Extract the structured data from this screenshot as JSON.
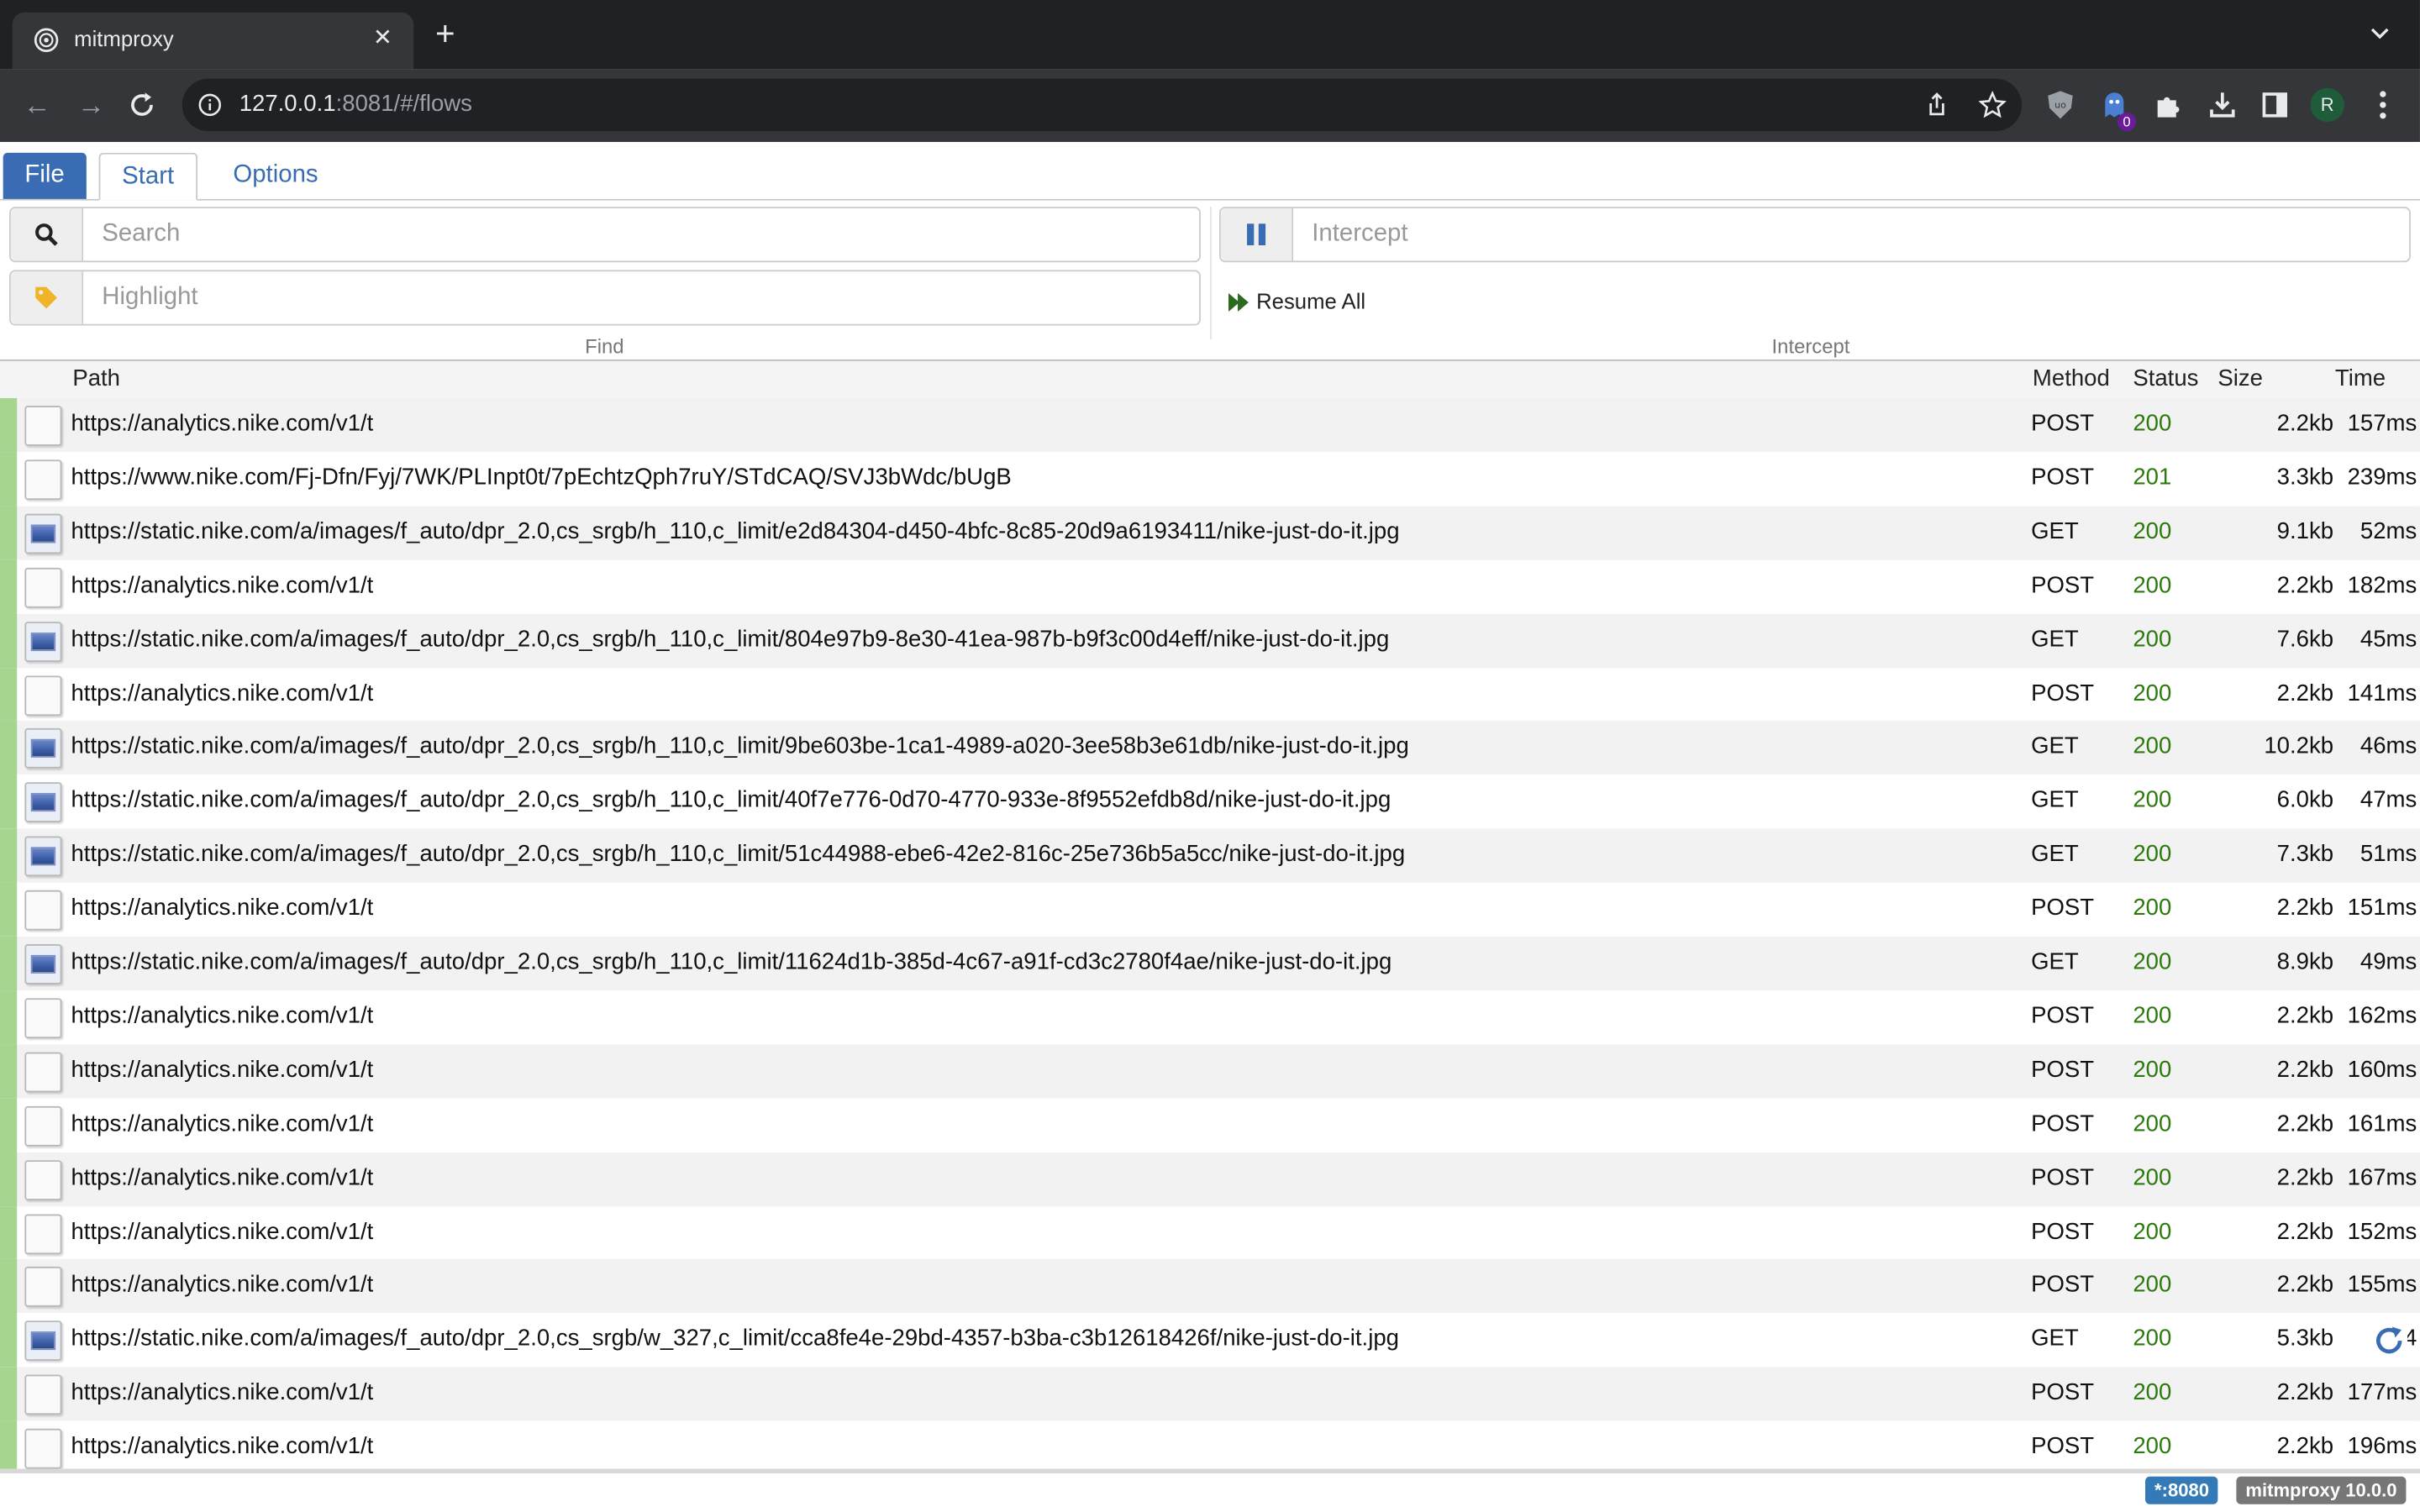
{
  "browser": {
    "tab_title": "mitmproxy",
    "url_host": "127.0.0.1",
    "url_rest": ":8081/#/flows",
    "avatar_letter": "R",
    "extension_badge": "0"
  },
  "menu": {
    "tabs": [
      "File",
      "Start",
      "Options"
    ],
    "search_placeholder": "Search",
    "highlight_placeholder": "Highlight",
    "intercept_placeholder": "Intercept",
    "resume_all": "Resume All",
    "find_label": "Find",
    "intercept_label": "Intercept"
  },
  "table": {
    "columns": [
      "Path",
      "Method",
      "Status",
      "Size",
      "Time"
    ],
    "rows": [
      {
        "icon": "plain",
        "path": "https://analytics.nike.com/v1/t",
        "method": "POST",
        "status": "200",
        "size": "2.2kb",
        "time": "157ms"
      },
      {
        "icon": "plain",
        "path": "https://www.nike.com/Fj-Dfn/Fyj/7WK/PLInpt0t/7pEchtzQph7ruY/STdCAQ/SVJ3bWdc/bUgB",
        "method": "POST",
        "status": "201",
        "size": "3.3kb",
        "time": "239ms"
      },
      {
        "icon": "image",
        "path": "https://static.nike.com/a/images/f_auto/dpr_2.0,cs_srgb/h_110,c_limit/e2d84304-d450-4bfc-8c85-20d9a6193411/nike-just-do-it.jpg",
        "method": "GET",
        "status": "200",
        "size": "9.1kb",
        "time": "52ms"
      },
      {
        "icon": "plain",
        "path": "https://analytics.nike.com/v1/t",
        "method": "POST",
        "status": "200",
        "size": "2.2kb",
        "time": "182ms"
      },
      {
        "icon": "image",
        "path": "https://static.nike.com/a/images/f_auto/dpr_2.0,cs_srgb/h_110,c_limit/804e97b9-8e30-41ea-987b-b9f3c00d4eff/nike-just-do-it.jpg",
        "method": "GET",
        "status": "200",
        "size": "7.6kb",
        "time": "45ms"
      },
      {
        "icon": "plain",
        "path": "https://analytics.nike.com/v1/t",
        "method": "POST",
        "status": "200",
        "size": "2.2kb",
        "time": "141ms"
      },
      {
        "icon": "image",
        "path": "https://static.nike.com/a/images/f_auto/dpr_2.0,cs_srgb/h_110,c_limit/9be603be-1ca1-4989-a020-3ee58b3e61db/nike-just-do-it.jpg",
        "method": "GET",
        "status": "200",
        "size": "10.2kb",
        "time": "46ms"
      },
      {
        "icon": "image",
        "path": "https://static.nike.com/a/images/f_auto/dpr_2.0,cs_srgb/h_110,c_limit/40f7e776-0d70-4770-933e-8f9552efdb8d/nike-just-do-it.jpg",
        "method": "GET",
        "status": "200",
        "size": "6.0kb",
        "time": "47ms"
      },
      {
        "icon": "image",
        "path": "https://static.nike.com/a/images/f_auto/dpr_2.0,cs_srgb/h_110,c_limit/51c44988-ebe6-42e2-816c-25e736b5a5cc/nike-just-do-it.jpg",
        "method": "GET",
        "status": "200",
        "size": "7.3kb",
        "time": "51ms"
      },
      {
        "icon": "plain",
        "path": "https://analytics.nike.com/v1/t",
        "method": "POST",
        "status": "200",
        "size": "2.2kb",
        "time": "151ms"
      },
      {
        "icon": "image",
        "path": "https://static.nike.com/a/images/f_auto/dpr_2.0,cs_srgb/h_110,c_limit/11624d1b-385d-4c67-a91f-cd3c2780f4ae/nike-just-do-it.jpg",
        "method": "GET",
        "status": "200",
        "size": "8.9kb",
        "time": "49ms"
      },
      {
        "icon": "plain",
        "path": "https://analytics.nike.com/v1/t",
        "method": "POST",
        "status": "200",
        "size": "2.2kb",
        "time": "162ms"
      },
      {
        "icon": "plain",
        "path": "https://analytics.nike.com/v1/t",
        "method": "POST",
        "status": "200",
        "size": "2.2kb",
        "time": "160ms"
      },
      {
        "icon": "plain",
        "path": "https://analytics.nike.com/v1/t",
        "method": "POST",
        "status": "200",
        "size": "2.2kb",
        "time": "161ms"
      },
      {
        "icon": "plain",
        "path": "https://analytics.nike.com/v1/t",
        "method": "POST",
        "status": "200",
        "size": "2.2kb",
        "time": "167ms"
      },
      {
        "icon": "plain",
        "path": "https://analytics.nike.com/v1/t",
        "method": "POST",
        "status": "200",
        "size": "2.2kb",
        "time": "152ms"
      },
      {
        "icon": "plain",
        "path": "https://analytics.nike.com/v1/t",
        "method": "POST",
        "status": "200",
        "size": "2.2kb",
        "time": "155ms"
      },
      {
        "icon": "image",
        "path": "https://static.nike.com/a/images/f_auto/dpr_2.0,cs_srgb/w_327,c_limit/cca8fe4e-29bd-4357-b3ba-c3b12618426f/nike-just-do-it.jpg",
        "method": "GET",
        "status": "200",
        "size": "5.3kb",
        "time": "4",
        "loading": true
      },
      {
        "icon": "plain",
        "path": "https://analytics.nike.com/v1/t",
        "method": "POST",
        "status": "200",
        "size": "2.2kb",
        "time": "177ms"
      },
      {
        "icon": "plain",
        "path": "https://analytics.nike.com/v1/t",
        "method": "POST",
        "status": "200",
        "size": "2.2kb",
        "time": "196ms"
      }
    ]
  },
  "footer": {
    "listen": "*:8080",
    "version": "mitmproxy 10.0.0"
  },
  "colors": {
    "accent": "#396cb2",
    "status_ok": "#2c7a0e",
    "flow_bar": "#a5d58f"
  }
}
